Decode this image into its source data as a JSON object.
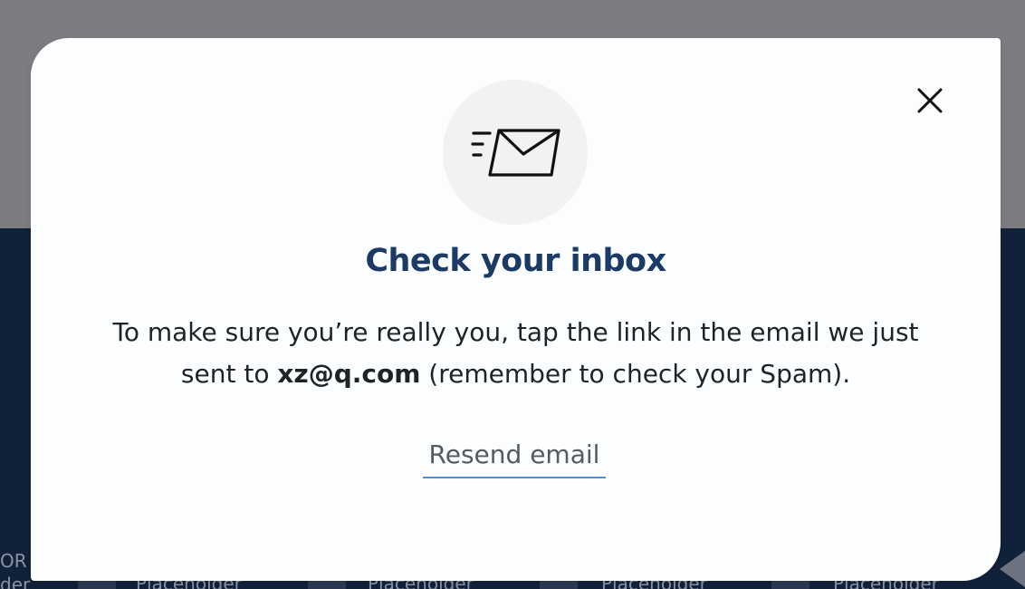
{
  "background": {
    "left_text_lines": [
      "OR",
      "der"
    ],
    "cards": [
      {
        "label": "Placeholder"
      },
      {
        "label": "Placeholder"
      },
      {
        "label": "Placeholder"
      },
      {
        "label": "Placeholder"
      }
    ]
  },
  "modal": {
    "icon": "envelope-sent-icon",
    "close_icon": "close-icon",
    "title": "Check your inbox",
    "message_before": "To make sure you’re really you, tap the link in the email we just sent to ",
    "email": "xz@q.com",
    "message_after": " (remember to check your Spam).",
    "resend_label": "Resend email"
  },
  "colors": {
    "title": "#1b3a66",
    "link_underline": "#4a90e2",
    "overlay_top": "#7c7d80",
    "page_dark": "#11213a"
  }
}
